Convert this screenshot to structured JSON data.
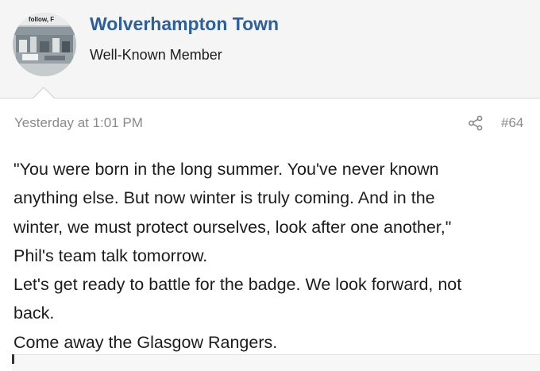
{
  "user": {
    "name": "Wolverhampton Town",
    "title": "Well-Known Member",
    "avatar_caption": "follow, F"
  },
  "post": {
    "date": "Yesterday at 1:01 PM",
    "number": "#64",
    "share_icon": "share-icon",
    "lines": [
      "\"You were born in the long summer. You've never known",
      "anything else. But now winter is truly coming. And in the",
      "winter, we must protect ourselves, look after one another,\"",
      "Phil's team talk tomorrow.",
      "Let's get ready to battle for the badge. We look forward, not",
      "back.",
      "Come away the Glasgow Rangers."
    ]
  },
  "colors": {
    "header_background": "#f5f5f5",
    "username": "#2d5f9a",
    "meta_text": "#8a8a8a",
    "body_text": "#1c1c1c"
  }
}
